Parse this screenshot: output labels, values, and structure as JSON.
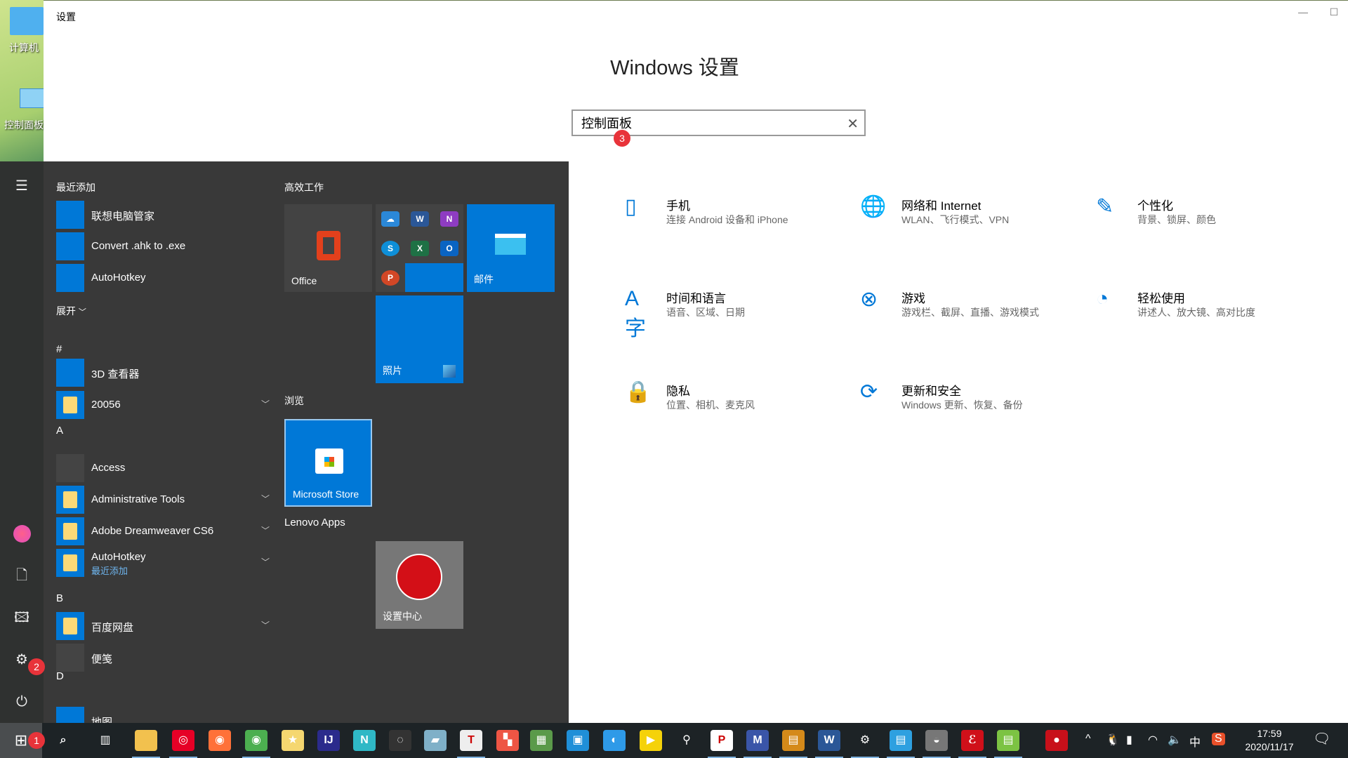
{
  "desktop": {
    "icons": [
      {
        "label": "计算机"
      },
      {
        "label": "控制面板"
      }
    ]
  },
  "window": {
    "title": "设置",
    "heading": "Windows 设置",
    "minimize": "—",
    "maximize": "☐",
    "search": {
      "value": "控制面板",
      "clear_icon": "close-icon",
      "badge": "3"
    },
    "items": [
      {
        "title": "手机",
        "subtitle": "连接 Android 设备和 iPhone",
        "icon": "phone-icon"
      },
      {
        "title": "网络和 Internet",
        "subtitle": "WLAN、飞行模式、VPN",
        "icon": "globe-icon"
      },
      {
        "title": "个性化",
        "subtitle": "背景、锁屏、颜色",
        "icon": "personalize-icon"
      },
      {
        "title": "时间和语言",
        "subtitle": "语音、区域、日期",
        "icon": "time-language-icon"
      },
      {
        "title": "游戏",
        "subtitle": "游戏栏、截屏、直播、游戏模式",
        "icon": "xbox-icon"
      },
      {
        "title": "轻松使用",
        "subtitle": "讲述人、放大镜、高对比度",
        "icon": "ease-of-access-icon"
      },
      {
        "title": "隐私",
        "subtitle": "位置、相机、麦克风",
        "icon": "lock-icon"
      },
      {
        "title": "更新和安全",
        "subtitle": "Windows 更新、恢复、备份",
        "icon": "update-icon"
      }
    ],
    "accent": "#0078d7"
  },
  "start_menu": {
    "recent_header": "最近添加",
    "expand": "展开",
    "settings_badge": "2",
    "apps": [
      {
        "label": "联想电脑管家"
      },
      {
        "label": "Convert .ahk to .exe"
      },
      {
        "label": "AutoHotkey"
      },
      {
        "label": "#"
      },
      {
        "label": "3D 查看器"
      },
      {
        "label": "20056"
      },
      {
        "label": "A"
      },
      {
        "label": "Access"
      },
      {
        "label": "Administrative Tools"
      },
      {
        "label": "Adobe Dreamweaver CS6"
      },
      {
        "label": "AutoHotkey",
        "sub": "最近添加"
      },
      {
        "label": "B"
      },
      {
        "label": "百度网盘"
      },
      {
        "label": "便笺"
      },
      {
        "label": "D"
      },
      {
        "label": "地图"
      }
    ],
    "groups": [
      {
        "label": "高效工作"
      },
      {
        "label": "浏览"
      },
      {
        "label": "Lenovo Apps"
      }
    ],
    "tiles": [
      {
        "label": "Office"
      },
      {
        "label": "邮件"
      },
      {
        "label": "照片"
      },
      {
        "label": "Microsoft Store"
      },
      {
        "label": "设置中心"
      }
    ]
  },
  "taskbar": {
    "start_badge": "1",
    "time": "17:59",
    "date": "2020/11/17",
    "ime": "中"
  }
}
